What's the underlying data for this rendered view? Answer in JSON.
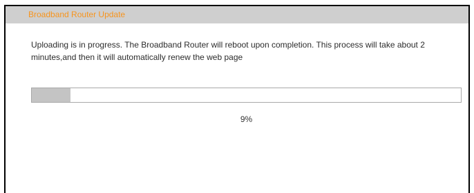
{
  "header": {
    "title": "Broadband Router Update"
  },
  "message": {
    "text": "Uploading is in progress. The Broadband Router will reboot upon completion. This process will take about 2 minutes,and then it will automatically renew the web page"
  },
  "progress": {
    "value": 0.09,
    "label": "9%"
  },
  "colors": {
    "header_background": "#cfcfcf",
    "header_text": "#f7941d",
    "progress_fill": "#c4c4c4",
    "progress_border": "#a8a8a8"
  }
}
